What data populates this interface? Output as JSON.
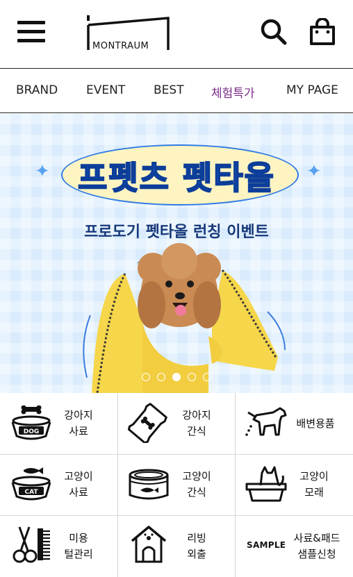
{
  "header": {
    "logo_text": "MONTRAUM",
    "menu_icon": "hamburger-menu-icon",
    "search_icon": "search-icon",
    "cart_icon": "shopping-bag-icon"
  },
  "nav": {
    "items": [
      {
        "label": "BRAND"
      },
      {
        "label": "EVENT"
      },
      {
        "label": "BEST"
      },
      {
        "label": "체험특가",
        "active": true,
        "color": "#7a2b86"
      },
      {
        "label": "MY PAGE"
      }
    ]
  },
  "banner": {
    "title": "프펫츠 펫타올",
    "subtitle": "프로도기 펫타올 런칭 이벤트",
    "slide_count": 5,
    "active_slide": 3,
    "colors": {
      "background": "#d9ebfc",
      "title": "#1f6fe3",
      "subtitle": "#17397a",
      "towel": "#f6d64a"
    }
  },
  "categories": [
    {
      "icon": "dog-food-bowl-icon",
      "line1": "강아지",
      "line2": "사료",
      "icon_text": "DOG"
    },
    {
      "icon": "dog-treat-bag-icon",
      "line1": "강아지",
      "line2": "간식"
    },
    {
      "icon": "dog-peeing-icon",
      "line1": "배변용품",
      "line2": ""
    },
    {
      "icon": "cat-food-bowl-icon",
      "line1": "고양이",
      "line2": "사료",
      "icon_text": "CAT"
    },
    {
      "icon": "cat-food-can-icon",
      "line1": "고양이",
      "line2": "간식"
    },
    {
      "icon": "cat-litter-box-icon",
      "line1": "고양이",
      "line2": "모래"
    },
    {
      "icon": "grooming-scissors-comb-icon",
      "line1": "미용",
      "line2": "털관리"
    },
    {
      "icon": "dog-house-icon",
      "line1": "리빙",
      "line2": "외출"
    },
    {
      "icon": "sample-text-icon",
      "line1": "사료&패드",
      "line2": "샘플신청",
      "icon_text": "SAMPLE"
    }
  ]
}
